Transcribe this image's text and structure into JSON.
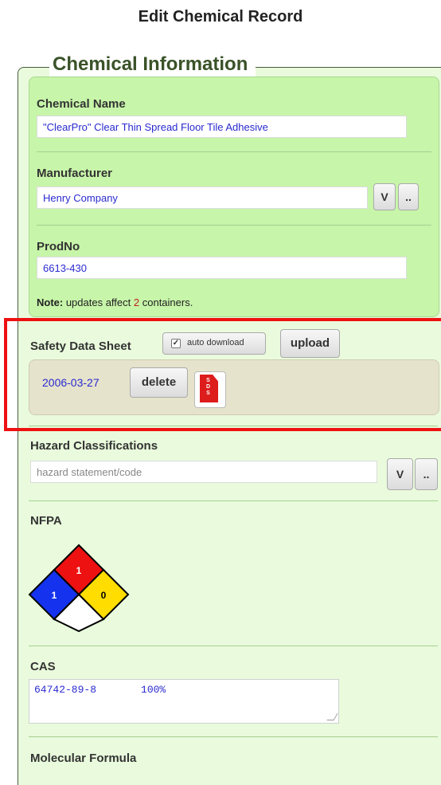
{
  "page": {
    "title": "Edit Chemical Record"
  },
  "chemical_info": {
    "legend": "Chemical Information",
    "chemical_name_label": "Chemical Name",
    "chemical_name_value": "\"ClearPro\" Clear Thin Spread Floor Tile Adhesive",
    "manufacturer_label": "Manufacturer",
    "manufacturer_value": "Henry Company",
    "manufacturer_v_button": "V",
    "manufacturer_more_button": "..",
    "prodno_label": "ProdNo",
    "prodno_value": "6613-430",
    "note_prefix": "Note:",
    "note_text_before": " updates affect ",
    "note_count": "2",
    "note_text_after": " containers."
  },
  "sds": {
    "label": "Safety Data Sheet",
    "auto_download_label": "auto download",
    "auto_download_checked": true,
    "upload_button": "upload",
    "date": "2006-03-27",
    "delete_button": "delete",
    "icon_letters": "SDS",
    "icon": "sds-document-icon"
  },
  "hazards": {
    "label": "Hazard Classifications",
    "placeholder": "hazard statement/code",
    "v_button": "V",
    "more_button": ".."
  },
  "nfpa": {
    "label": "NFPA",
    "health": "1",
    "flammability": "1",
    "instability": "0",
    "special": "",
    "colors": {
      "health": "#1533ee",
      "flammability": "#ee1111",
      "instability": "#ffdd00",
      "special": "#ffffff"
    }
  },
  "cas": {
    "label": "CAS",
    "number": "64742-89-8",
    "percent": "100%"
  },
  "molecular_formula": {
    "label": "Molecular Formula"
  },
  "colors": {
    "panel_green": "#c7f5a9",
    "background_green": "#e9fbdc",
    "sds_panel": "#e6e3cc",
    "highlight_red": "#ee1111",
    "value_blue": "#2a2ad0"
  }
}
